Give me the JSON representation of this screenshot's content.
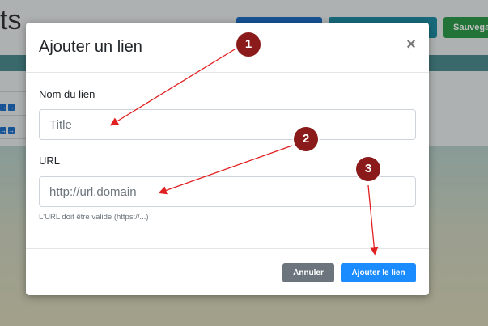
{
  "background": {
    "page_title_fragment": "ts",
    "buttons": [
      {
        "label": "",
        "color": "#1f6fc7"
      },
      {
        "label": "",
        "color": "#1f8ea5"
      },
      {
        "label": "Sauvega",
        "color": "#2d9a4a"
      }
    ]
  },
  "modal": {
    "title": "Ajouter un lien",
    "close_symbol": "×",
    "name_label": "Nom du lien",
    "name_placeholder": "Title",
    "url_label": "URL",
    "url_placeholder": "http://url.domain",
    "url_help": "L'URL doit être valide (https://...)",
    "cancel_label": "Annuler",
    "submit_label": "Ajouter le lien"
  },
  "annotations": {
    "badges": [
      "1",
      "2",
      "3"
    ],
    "color": "#8b1a1a",
    "arrow_color": "#e02020"
  }
}
